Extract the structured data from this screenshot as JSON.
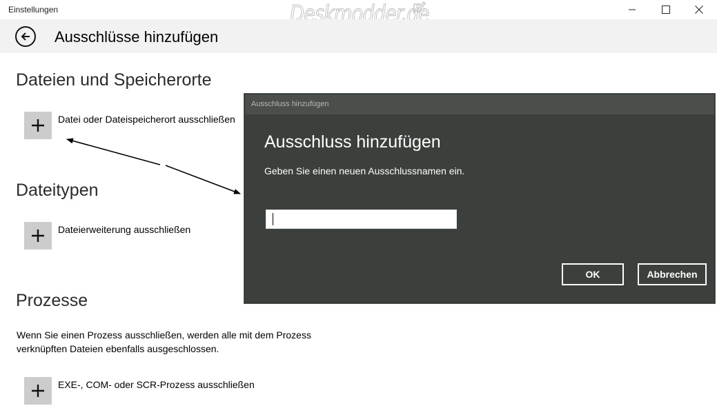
{
  "window": {
    "title": "Einstellungen",
    "watermark": "Deskmodder.de",
    "minimize_icon": "minimize-icon",
    "maximize_icon": "maximize-icon",
    "close_icon": "close-icon"
  },
  "header": {
    "back_icon": "back-arrow-icon",
    "title": "Ausschlüsse hinzufügen"
  },
  "sections": [
    {
      "heading": "Dateien und Speicherorte",
      "add_label": "Datei oder Dateispeicherort ausschließen"
    },
    {
      "heading": "Dateitypen",
      "add_label": "Dateierweiterung ausschließen"
    },
    {
      "heading": "Prozesse",
      "description": "Wenn Sie einen Prozess ausschließen, werden alle mit dem Prozess verknüpften Dateien ebenfalls ausgeschlossen.",
      "add_label": "EXE-, COM- oder SCR-Prozess ausschließen"
    }
  ],
  "dialog": {
    "window_title": "Ausschluss hinzufügen",
    "heading": "Ausschluss hinzufügen",
    "prompt": "Geben Sie einen neuen Ausschlussnamen ein.",
    "input_value": "",
    "ok_label": "OK",
    "cancel_label": "Abbrechen"
  },
  "colors": {
    "dialog_background": "#3b403c",
    "tile_background": "#cccccc",
    "header_background": "#f2f2f2"
  }
}
